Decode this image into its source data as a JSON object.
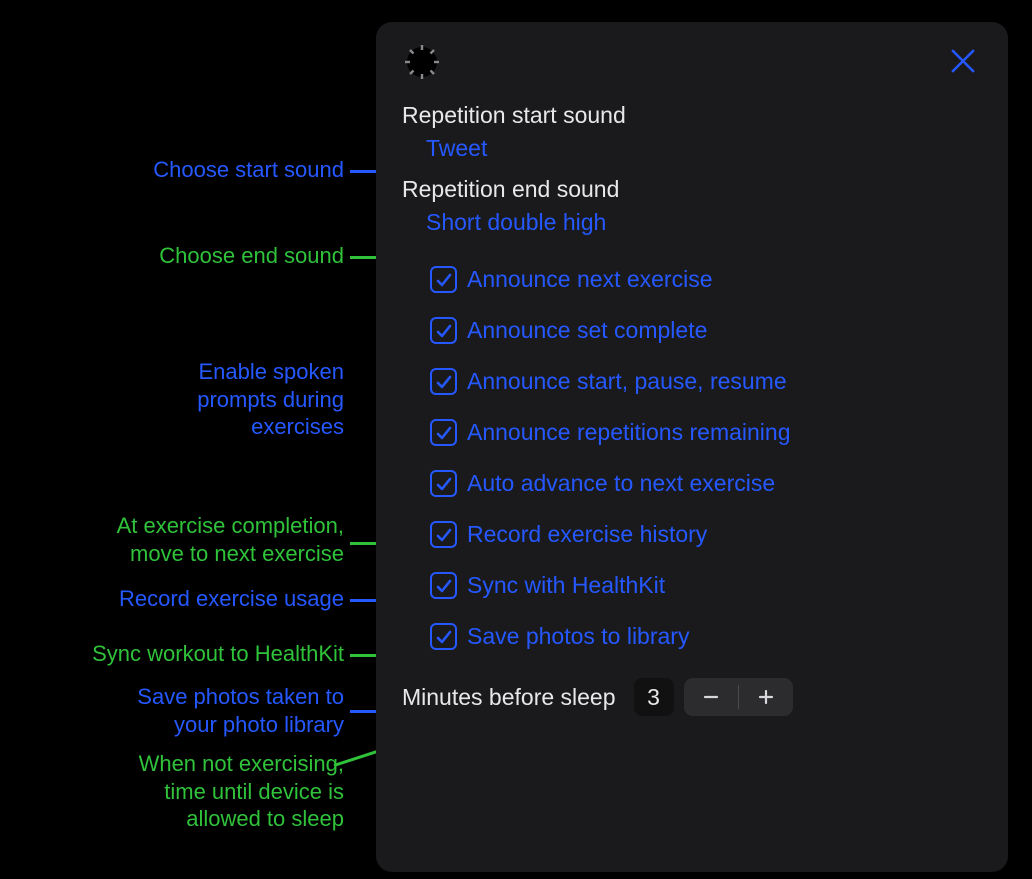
{
  "annotations": {
    "start_sound": "Choose start sound",
    "end_sound": "Choose end sound",
    "spoken_prompts": "Enable spoken\nprompts during\nexercises",
    "auto_advance": "At exercise completion,\nmove to next exercise",
    "record_history": "Record exercise usage",
    "sync_healthkit": "Sync workout to HealthKit",
    "save_photos": "Save photos taken to\nyour photo library",
    "sleep": "When not exercising,\ntime until device is\nallowed to sleep"
  },
  "panel": {
    "start_sound_label": "Repetition start sound",
    "start_sound_value": "Tweet",
    "end_sound_label": "Repetition end sound",
    "end_sound_value": "Short double high",
    "checks": {
      "announce_next": "Announce next exercise",
      "announce_set": "Announce set complete",
      "announce_spr": "Announce start, pause, resume",
      "announce_reps": "Announce repetitions remaining",
      "auto_advance": "Auto advance to next exercise",
      "record_history": "Record exercise history",
      "sync_healthkit": "Sync with HealthKit",
      "save_photos": "Save photos to library"
    },
    "sleep_label": "Minutes before sleep",
    "sleep_value": "3"
  }
}
